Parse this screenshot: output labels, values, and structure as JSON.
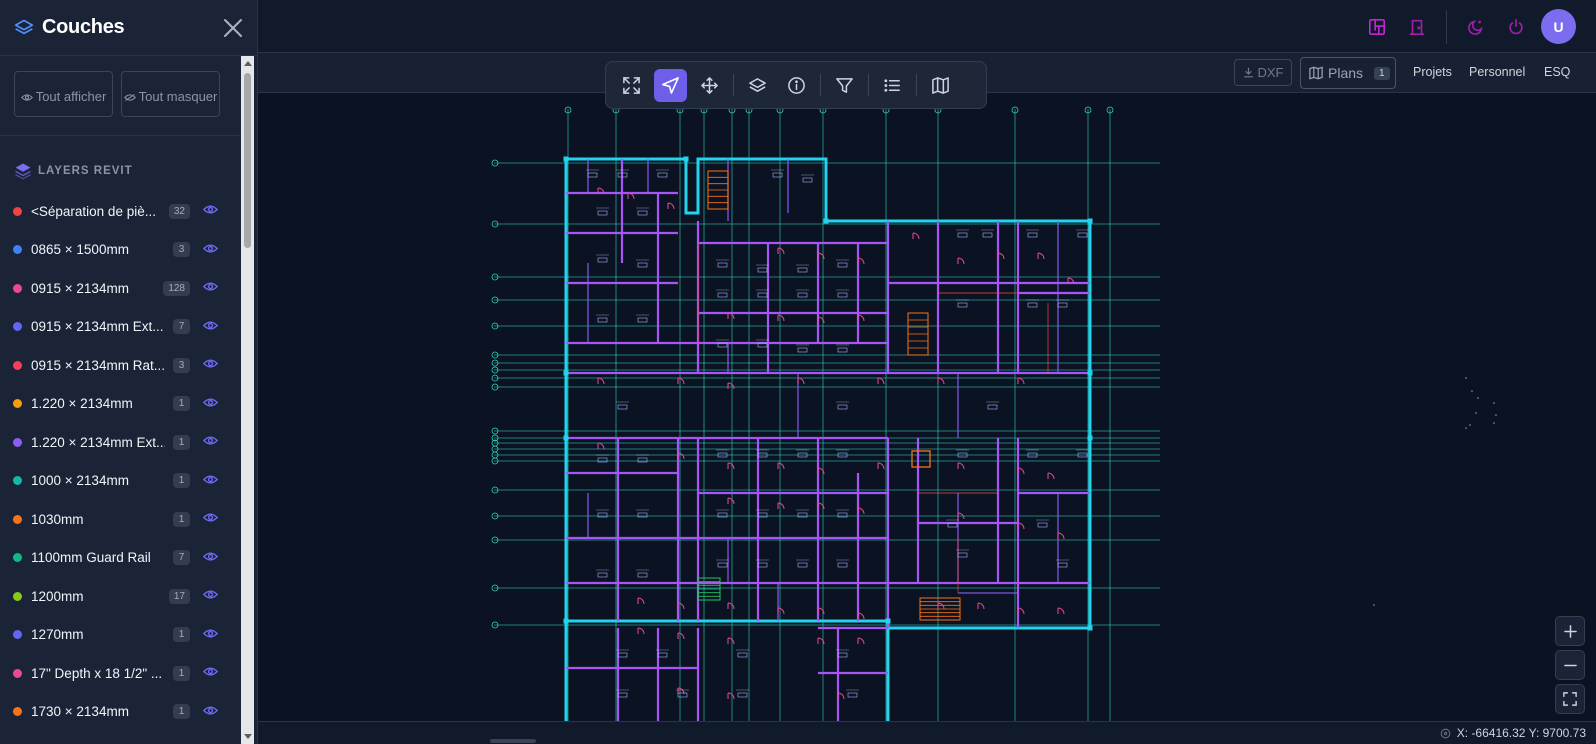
{
  "sidebar": {
    "title": "Couches",
    "show_all": "Tout afficher",
    "hide_all": "Tout masquer",
    "section_title": "LAYERS REVIT",
    "layers": [
      {
        "name": "<Séparation de piè...",
        "count": "32",
        "color": "#ef4444"
      },
      {
        "name": "0865 × 1500mm",
        "count": "3",
        "color": "#3b82f6"
      },
      {
        "name": "0915 × 2134mm",
        "count": "128",
        "color": "#ec4899"
      },
      {
        "name": "0915 × 2134mm Ext...",
        "count": "7",
        "color": "#6366f1"
      },
      {
        "name": "0915 × 2134mm Rat...",
        "count": "3",
        "color": "#f43f5e"
      },
      {
        "name": "1.220 × 2134mm",
        "count": "1",
        "color": "#f59e0b"
      },
      {
        "name": "1.220 × 2134mm Ext...",
        "count": "1",
        "color": "#8b5cf6"
      },
      {
        "name": "1000 × 2134mm",
        "count": "1",
        "color": "#14b8a6"
      },
      {
        "name": "1030mm",
        "count": "1",
        "color": "#f97316"
      },
      {
        "name": "1100mm Guard Rail",
        "count": "7",
        "color": "#10b981"
      },
      {
        "name": "1200mm",
        "count": "17",
        "color": "#84cc16"
      },
      {
        "name": "1270mm",
        "count": "1",
        "color": "#6366f1"
      },
      {
        "name": "17\" Depth x 18 1/2\" ...",
        "count": "1",
        "color": "#ec4899"
      },
      {
        "name": "1730 × 2134mm",
        "count": "1",
        "color": "#f97316"
      }
    ]
  },
  "subbar": {
    "dxf_label": "DXF",
    "plans_label": "Plans",
    "plans_count": "1",
    "nav": [
      "Projets",
      "Personnel",
      "ESQ"
    ]
  },
  "topbar": {
    "avatar_initial": "U"
  },
  "icons": {
    "layers": "layers-icon",
    "close": "close-icon",
    "eye": "eye-icon",
    "expand": "expand-icon",
    "select": "navigation-arrow-icon",
    "pan": "move-icon",
    "info": "info-icon",
    "filter": "filter-icon",
    "list": "list-icon",
    "map": "map-icon",
    "door": "door-icon",
    "power": "power-icon",
    "theme": "moon-star-icon"
  },
  "colors": {
    "accent": "#6d5fe8",
    "wall": "#a855f7",
    "grid": "#2dd4bf",
    "frame": "#22d3ee"
  },
  "status": {
    "coords": "X: -66416.32 Y: 9700.73"
  }
}
